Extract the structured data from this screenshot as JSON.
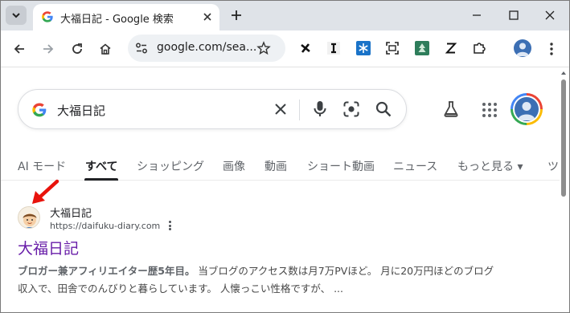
{
  "tab": {
    "title": "大福日記 - Google 検索"
  },
  "toolbar": {
    "url": "google.com/sea..."
  },
  "extensions": [
    "x-icon-ext",
    "I",
    "snowflake",
    "screenshot",
    "tree",
    "Z",
    "puzzle"
  ],
  "search": {
    "query": "大福日記"
  },
  "tabs": [
    "AI モード",
    "すべて",
    "ショッピング",
    "画像",
    "動画",
    "ショート動画",
    "ニュース",
    "もっと見る ▾",
    "ツ"
  ],
  "result": {
    "site_name": "大福日記",
    "url": "https://daifuku-diary.com",
    "title": "大福日記",
    "snippet_bold": "ブロガー兼アフィリエイター歴5年目。",
    "snippet_line1": " 当ブログのアクセス数は月7万PVほど。 月に20万円ほどのブログ",
    "snippet_line2": "収入で、田舎でのんびりと暮らしています。 人懐っこい性格ですが、 ..."
  },
  "colors": {
    "visited_link": "#681da8",
    "arrow": "#e8130c"
  }
}
